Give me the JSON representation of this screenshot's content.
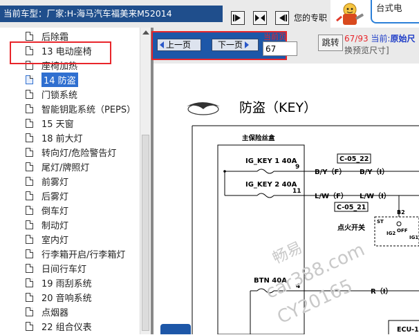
{
  "header": {
    "vehicle_label": "当前车型：",
    "vehicle_value": "厂家:H-海马汽车福美来M52014",
    "help_text": "您的专职",
    "nav_icons": [
      "first-page-icon",
      "fit-icon",
      "last-page-icon"
    ],
    "ad_text": "台式电"
  },
  "sidebar": {
    "items": [
      {
        "label": "后除霜"
      },
      {
        "label": "13 电动座椅"
      },
      {
        "label": "座椅加热"
      },
      {
        "label": "14 防盗",
        "selected": true
      },
      {
        "label": "门锁系统"
      },
      {
        "label": "智能钥匙系统（PEPS）"
      },
      {
        "label": "15 天窗"
      },
      {
        "label": "18 前大灯"
      },
      {
        "label": "转向灯/危险警告灯"
      },
      {
        "label": "尾灯/牌照灯"
      },
      {
        "label": "前雾灯"
      },
      {
        "label": "后雾灯"
      },
      {
        "label": "倒车灯"
      },
      {
        "label": "制动灯"
      },
      {
        "label": "室内灯"
      },
      {
        "label": "行李箱开启/行李箱灯"
      },
      {
        "label": "日间行车灯"
      },
      {
        "label": "19 雨刮系统"
      },
      {
        "label": "20 音响系统"
      },
      {
        "label": "点烟器"
      },
      {
        "label": "22 组合仪表"
      }
    ]
  },
  "pager": {
    "prev_label": "上一页",
    "next_label": "下一页",
    "current_label": "当前页",
    "page_value": "67",
    "goto_label": "跳转",
    "page_count": "67/93",
    "current_prefix": "当前:",
    "current_name": "原始尺",
    "zoom_hint": "换预览尺寸]"
  },
  "document": {
    "title": "防盗（KEY）",
    "fuse_box_label": "主保险丝盒",
    "fuses": [
      {
        "name": "IG_KEY 1 40A",
        "pin": "9",
        "wire": "B/Y（F）",
        "wire_out": "B/Y（I）",
        "connector": "C-05_22"
      },
      {
        "name": "IG_KEY 2 40A",
        "pin": "11",
        "wire": "L/W（F）",
        "wire_out": "L/W（I）",
        "connector": "C-05_21"
      },
      {
        "name": "BTN 40A",
        "pin": "4",
        "wire": "",
        "wire_out": "R（I）",
        "connector": ""
      }
    ],
    "switch_label": "点火开关",
    "switch_pins": [
      "B2",
      "ST",
      "OFF",
      "IG2",
      "IG1"
    ],
    "ecu_label": "ECU-1",
    "watermark": [
      "畅易",
      "car388.com",
      "CY20165"
    ]
  }
}
